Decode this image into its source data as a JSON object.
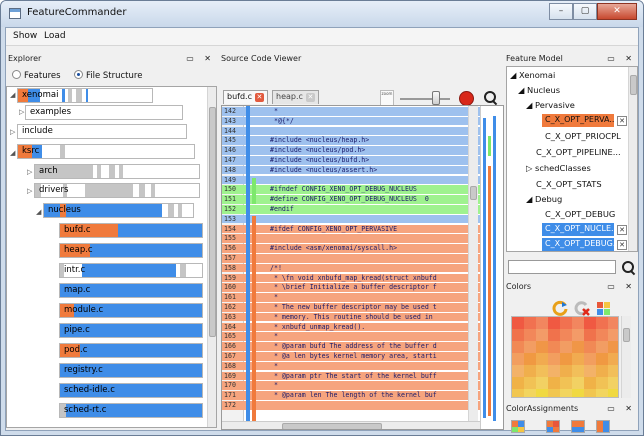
{
  "window": {
    "title": "FeatureCommander",
    "minimize": "–",
    "maximize": "▢",
    "close": "✕"
  },
  "menu": [
    "Show",
    "Load"
  ],
  "explorer": {
    "title": "Explorer",
    "mode_features": "Features",
    "mode_filestructure": "File Structure",
    "nodes": [
      "xenomai",
      "examples",
      "include",
      "ksrc",
      "arch",
      "drivers",
      "nucleus",
      "bufd.c",
      "heap.c",
      "intr.c",
      "map.c",
      "module.c",
      "pipe.c",
      "pod.c",
      "registry.c",
      "sched-idle.c",
      "sched-rt.c"
    ]
  },
  "source_viewer": {
    "title": "Source Code Viewer",
    "zoom_label": "zoom",
    "tabs": [
      {
        "label": "bufd.c",
        "active": true
      },
      {
        "label": "heap.c",
        "active": false
      }
    ],
    "lines": [
      {
        "n": "142",
        "t": " *",
        "c": "blue"
      },
      {
        "n": "143",
        "t": " *@{*/",
        "c": "blue"
      },
      {
        "n": "144",
        "t": "",
        "c": "blue"
      },
      {
        "n": "145",
        "t": "#include <nucleus/heap.h>",
        "c": "blue"
      },
      {
        "n": "146",
        "t": "#include <nucleus/pod.h>",
        "c": "blue"
      },
      {
        "n": "147",
        "t": "#include <nucleus/bufd.h>",
        "c": "blue"
      },
      {
        "n": "148",
        "t": "#include <nucleus/assert.h>",
        "c": "blue"
      },
      {
        "n": "149",
        "t": "",
        "c": "blue"
      },
      {
        "n": "150",
        "t": "#ifndef CONFIG_XENO_OPT_DEBUG_NUCLEUS",
        "c": "green"
      },
      {
        "n": "151",
        "t": "#define CONFIG_XENO_OPT_DEBUG_NUCLEUS  0",
        "c": "green"
      },
      {
        "n": "152",
        "t": "#endif",
        "c": "green"
      },
      {
        "n": "153",
        "t": "",
        "c": "blue"
      },
      {
        "n": "154",
        "t": "#ifdef CONFIG_XENO_OPT_PERVASIVE",
        "c": "orange"
      },
      {
        "n": "155",
        "t": "",
        "c": "orange"
      },
      {
        "n": "156",
        "t": "#include <asm/xenomai/syscall.h>",
        "c": "orange"
      },
      {
        "n": "157",
        "t": "",
        "c": "orange"
      },
      {
        "n": "158",
        "t": "/*!",
        "c": "orange"
      },
      {
        "n": "159",
        "t": " * \\fn void xnbufd_map_kread(struct xnbufd",
        "c": "orange"
      },
      {
        "n": "160",
        "t": " * \\brief Initialize a buffer descriptor f",
        "c": "orange"
      },
      {
        "n": "161",
        "t": " *",
        "c": "orange"
      },
      {
        "n": "162",
        "t": " * The new buffer descriptor may be used t",
        "c": "orange"
      },
      {
        "n": "163",
        "t": " * memory. This routine should be used in",
        "c": "orange"
      },
      {
        "n": "164",
        "t": " * xnbufd_unmap_kread().",
        "c": "orange"
      },
      {
        "n": "165",
        "t": " *",
        "c": "orange"
      },
      {
        "n": "166",
        "t": " * @param bufd The address of the buffer d",
        "c": "orange"
      },
      {
        "n": "167",
        "t": " * @a len bytes kernel memory area, starti",
        "c": "orange"
      },
      {
        "n": "168",
        "t": " *",
        "c": "orange"
      },
      {
        "n": "169",
        "t": " * @param ptr The start of the kernel buff",
        "c": "orange"
      },
      {
        "n": "170",
        "t": " *",
        "c": "orange"
      },
      {
        "n": "171",
        "t": " * @param len The length of the kernel buf",
        "c": "orange"
      },
      {
        "n": "172",
        "t": "",
        "c": "orange"
      }
    ]
  },
  "feature_model": {
    "title": "Feature Model",
    "items": [
      {
        "label": "Xenomai",
        "prefix": "◢"
      },
      {
        "label": "Nucleus",
        "prefix": "◢"
      },
      {
        "label": "Pervasive",
        "prefix": "◢"
      },
      {
        "label": "C_X_OPT_PERVA...",
        "prefix": ""
      },
      {
        "label": "C_X_OPT_PRIOCPL",
        "prefix": ""
      },
      {
        "label": "C_X_OPT_PIPELINE...",
        "prefix": ""
      },
      {
        "label": "schedClasses",
        "prefix": "▷"
      },
      {
        "label": "C_X_OPT_STATS",
        "prefix": ""
      },
      {
        "label": "Debug",
        "prefix": "◢"
      },
      {
        "label": "C_X_OPT_DEBUG",
        "prefix": ""
      },
      {
        "label": "C_X_OPT_NUCLE...",
        "prefix": ""
      },
      {
        "label": "C_X_OPT_DEBUG...",
        "prefix": ""
      }
    ],
    "x_label": "✕"
  },
  "colors": {
    "title": "Colors"
  },
  "color_assignments": {
    "title": "ColorAssignments"
  },
  "dock_buttons": "▭ ✕",
  "palette": {
    "blue": "#3f8de8",
    "orange": "#f07a3c",
    "green": "#7de86c",
    "gray": "#bdbdbd"
  }
}
